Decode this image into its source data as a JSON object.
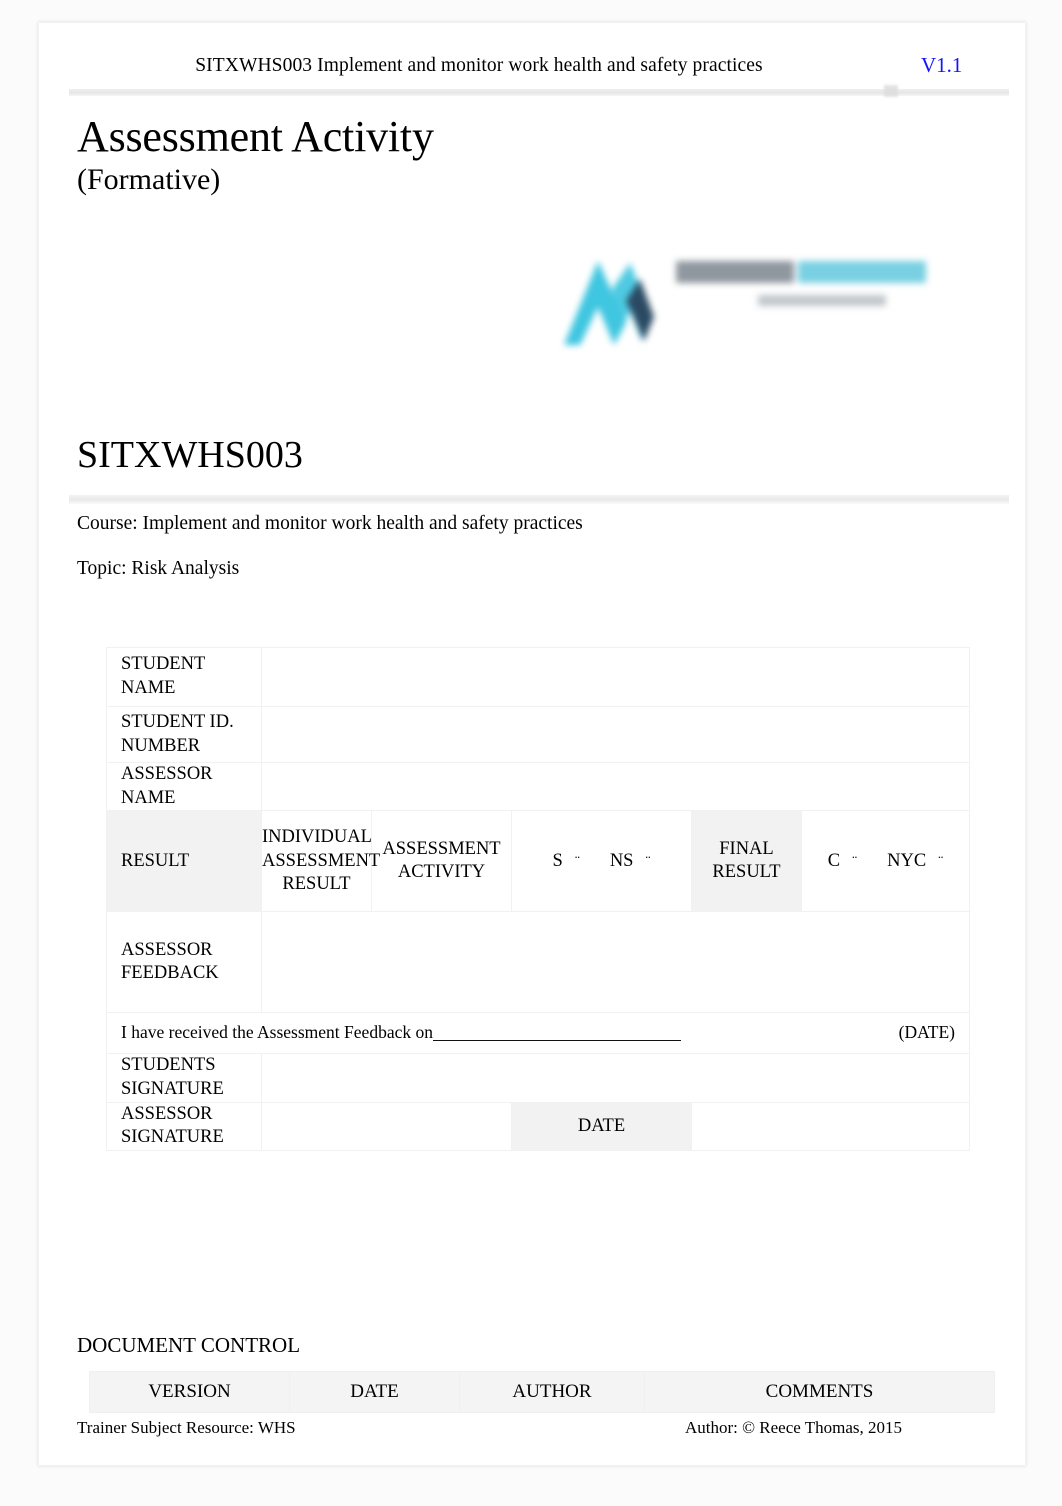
{
  "header": {
    "title": "SITXWHS003 Implement and monitor work health and safety practices",
    "version": "V1.1",
    "version_color": "#1414ff"
  },
  "title_block": {
    "main": "Assessment Activity",
    "sub": "(Formative)"
  },
  "logo": {
    "name": "organisation-logo",
    "mark_colors": [
      "#3fc6e0",
      "#2a4a63"
    ],
    "word_colors": [
      "#76808a",
      "#62c8dd"
    ]
  },
  "unit": {
    "code": "SITXWHS003",
    "course": "Course: Implement and monitor work health and safety practices",
    "topic": "Topic: Risk Analysis"
  },
  "result_table": {
    "student_name_label": "STUDENT NAME",
    "student_name_value": "",
    "student_id_label": "STUDENT ID. NUMBER",
    "student_id_value": "",
    "assessor_name_label": "ASSESSOR NAME",
    "assessor_name_value": "",
    "result_label": "RESULT",
    "individual_assessment_result_label": "INDIVIDUAL ASSESSMENT RESULT",
    "assessment_activity_label": "ASSESSMENT ACTIVITY",
    "s_label": "S",
    "ns_label": "NS",
    "final_result_label": "FINAL RESULT",
    "c_label": "C",
    "nyc_label": "NYC",
    "checkbox_glyph": "¨",
    "assessor_feedback_label": "ASSESSOR FEEDBACK",
    "assessor_feedback_value": "",
    "received_text": "I have received the Assessment Feedback on",
    "received_date_label": "(DATE)",
    "students_signature_label": "STUDENTS SIGNATURE",
    "students_signature_value": "",
    "assessor_signature_label": "ASSESSOR SIGNATURE",
    "assessor_signature_value": "",
    "date_label": "DATE",
    "date_value": ""
  },
  "document_control": {
    "heading": "DOCUMENT CONTROL",
    "columns": [
      "VERSION",
      "DATE",
      "AUTHOR",
      "COMMENTS"
    ]
  },
  "footer": {
    "left": "Trainer Subject Resource: WHS",
    "right": "Author: © Reece Thomas, 2015"
  }
}
